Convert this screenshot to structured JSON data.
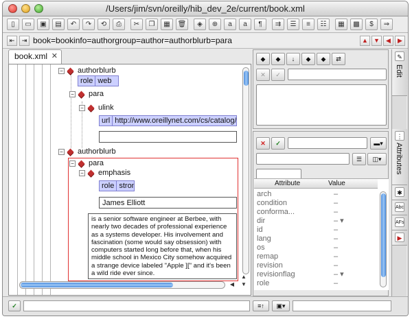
{
  "window": {
    "title": "/Users/jim/svn/oreilly/hib_dev_2e/current/book.xml"
  },
  "toolbar": {
    "icons": [
      "new-icon",
      "open-icon",
      "save-icon",
      "save-all-icon",
      "undo-icon",
      "redo-icon",
      "revert-icon",
      "print-icon",
      "cut-icon",
      "copy-icon",
      "paste-icon",
      "delete-icon",
      "split-icon",
      "join-icon",
      "change-icon",
      "insert-char-icon",
      "paragraph-icon",
      "indent-icon",
      "bullet-list-icon",
      "numbered-list-icon",
      "checklist-icon",
      "table-icon",
      "image-icon",
      "spellcheck-icon",
      "validate-icon"
    ],
    "glyphs": [
      "▯",
      "▭",
      "▣",
      "▤",
      "↶",
      "↷",
      "⟲",
      "⎙",
      "✂",
      "❐",
      "▦",
      "🗑",
      "◈",
      "⊕",
      "a",
      "a",
      "¶",
      "⇉",
      "☰",
      "≡",
      "☷",
      "▦",
      "▩",
      "$",
      "⇒"
    ]
  },
  "pathbar": {
    "path": "book=bookinfo=authorgroup=author=authorblurb=para"
  },
  "tabs": [
    {
      "label": "book.xml",
      "close": "✕"
    }
  ],
  "tree": {
    "n1": "authorblurb",
    "attr1": {
      "key": "role",
      "value": "web"
    },
    "n2": "para",
    "n3": "ulink",
    "attr2": {
      "key": "url",
      "value": "http://www.oreillynet.com/cs/catalog/vie"
    },
    "n4": "authorblurb",
    "n5": "para",
    "n6": "emphasis",
    "attr3": {
      "key": "role",
      "value": "strong"
    },
    "text1": "James Elliott",
    "para_lines": [
      "is a senior software engineer at Berbee, with",
      "nearly two decades of professional experience",
      "as a systems developer. His involvement and",
      "fascination (some would say obsession) with",
      "computers started long before that, when his",
      "middle school in Mexico City somehow acquired",
      "a strange device labeled \"Apple ][\" and it's been",
      "a wild ride ever since."
    ]
  },
  "attributes": {
    "header": {
      "attribute": "Attribute",
      "value": "Value"
    },
    "rows": [
      {
        "name": "arch",
        "value": "–"
      },
      {
        "name": "condition",
        "value": "–"
      },
      {
        "name": "conforma...",
        "value": "–"
      },
      {
        "name": "dir",
        "value": "– ▾"
      },
      {
        "name": "id",
        "value": "–"
      },
      {
        "name": "lang",
        "value": "–"
      },
      {
        "name": "os",
        "value": "–"
      },
      {
        "name": "remap",
        "value": "–"
      },
      {
        "name": "revision",
        "value": "–"
      },
      {
        "name": "revisionflag",
        "value": "– ▾"
      },
      {
        "name": "role",
        "value": "–"
      }
    ]
  },
  "sidetabs": {
    "edit": "Edit",
    "attributes": "Attributes"
  }
}
